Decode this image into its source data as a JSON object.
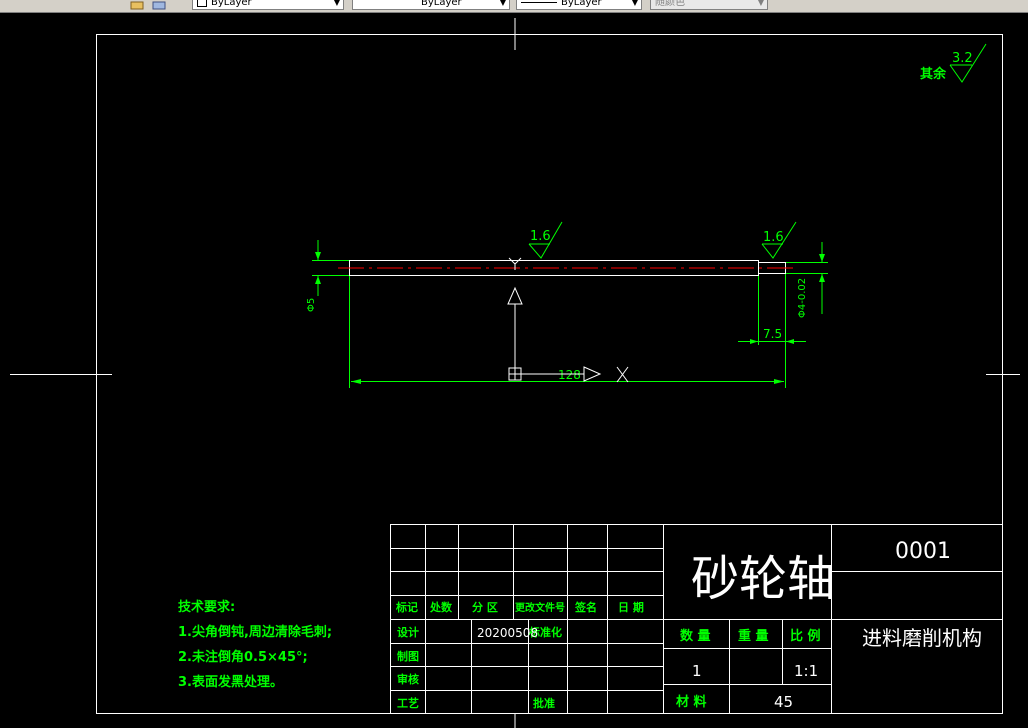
{
  "toolbar": {
    "layer_color": "ByLayer",
    "linetype": "ByLayer",
    "lineweight": "ByLayer",
    "plotstyle": "随颜色"
  },
  "roughness": {
    "other_label": "其余",
    "other_value": "3.2",
    "top_value": "1.6",
    "right_value": "1.6"
  },
  "dimensions": {
    "diameter_left": "Φ5",
    "diameter_right": "Φ4-0.02",
    "step_length": "7.5",
    "total_length": "128"
  },
  "notes": {
    "title": "技术要求:",
    "line1": "1.尖角倒钝,周边清除毛刺;",
    "line2": "2.未注倒角0.5×45°;",
    "line3": "3.表面发黑处理。"
  },
  "title_block": {
    "part_name": "砂轮轴",
    "drawing_no": "0001",
    "assembly": "进料磨削机构",
    "hdr_mark": "标记",
    "hdr_count": "处数",
    "hdr_zone": "分 区",
    "hdr_doc": "更改文件号",
    "hdr_sign": "签名",
    "hdr_date": "日 期",
    "lbl_design": "设计",
    "design_date": "20200508",
    "lbl_standard": "标准化",
    "lbl_draw": "制图",
    "lbl_check": "审核",
    "lbl_process": "工艺",
    "lbl_approve": "批准",
    "lbl_qty": "数 量",
    "lbl_weight": "重 量",
    "lbl_scale": "比 例",
    "qty": "1",
    "scale": "1:1",
    "lbl_material": "材 料",
    "material": "45"
  },
  "colors": {
    "frame": "#ffffff",
    "dimension": "#00ff00",
    "centerline": "#ff0000",
    "background": "#000000",
    "toolbar": "#d4d0c8"
  }
}
